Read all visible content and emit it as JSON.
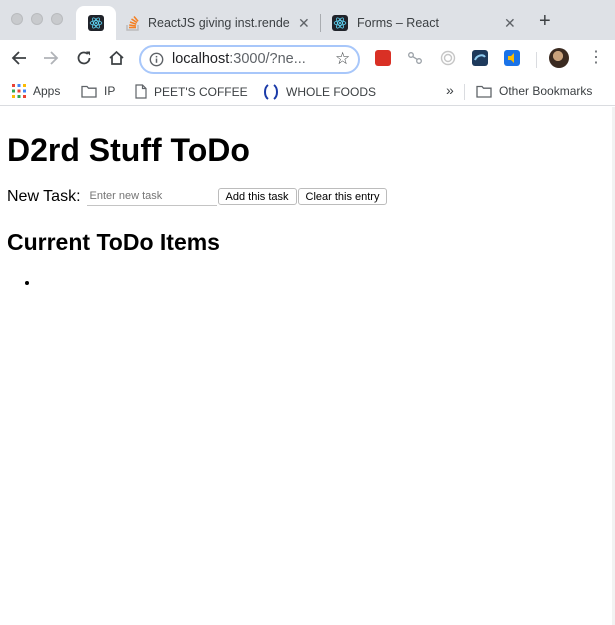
{
  "browser": {
    "tabs": [
      {
        "label": "",
        "active": true,
        "icon": "react-icon"
      },
      {
        "label": "ReactJS giving inst.rende",
        "active": false,
        "icon": "stackoverflow-icon"
      },
      {
        "label": "Forms – React",
        "active": false,
        "icon": "react-icon"
      }
    ],
    "new_tab_label": "+",
    "close_glyph": "✕",
    "omnibox": {
      "host": "localhost",
      "rest": ":3000/?ne..."
    },
    "bookmarks": [
      {
        "label": "Apps",
        "icon": "apps-grid-icon"
      },
      {
        "label": "IP",
        "icon": "folder-icon"
      },
      {
        "label": "PEET'S COFFEE",
        "icon": "page-icon"
      },
      {
        "label": "WHOLE FOODS",
        "icon": "wholefoods-icon"
      }
    ],
    "more_bookmarks": "»",
    "other_bookmarks": "Other Bookmarks"
  },
  "page": {
    "title": "D2rd Stuff ToDo",
    "new_task_label": "New Task:",
    "new_task_placeholder": "Enter new task",
    "new_task_value": "",
    "add_button": "Add this task",
    "clear_button": "Clear this entry",
    "list_heading": "Current ToDo Items",
    "items": [
      ""
    ]
  },
  "colors": {
    "tabstrip": "#dee1e6",
    "focus_ring": "#a8c7fa",
    "react_cyan": "#61dafb"
  }
}
